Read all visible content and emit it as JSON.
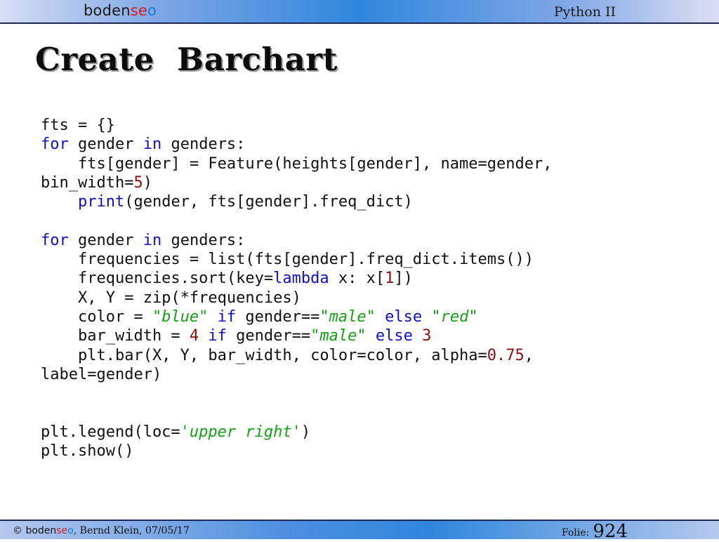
{
  "header": {
    "logo": {
      "part1": "boden",
      "part2": "se",
      "part3": "o"
    },
    "course": "Python II"
  },
  "slide": {
    "title": "Create  Barchart"
  },
  "code": {
    "lines": [
      [
        [
          "t",
          "fts = {}"
        ]
      ],
      [
        [
          "kw",
          "for"
        ],
        [
          "t",
          " gender "
        ],
        [
          "kw",
          "in"
        ],
        [
          "t",
          " genders:"
        ]
      ],
      [
        [
          "t",
          "    fts[gender] = Feature(heights[gender], name=gender,"
        ]
      ],
      [
        [
          "t",
          "bin_width="
        ],
        [
          "num",
          "5"
        ],
        [
          "t",
          ")"
        ]
      ],
      [
        [
          "t",
          "    "
        ],
        [
          "kw",
          "print"
        ],
        [
          "t",
          "(gender, fts[gender].freq_dict)"
        ]
      ],
      [],
      [
        [
          "kw",
          "for"
        ],
        [
          "t",
          " gender "
        ],
        [
          "kw",
          "in"
        ],
        [
          "t",
          " genders:"
        ]
      ],
      [
        [
          "t",
          "    frequencies = list(fts[gender].freq_dict.items())"
        ]
      ],
      [
        [
          "t",
          "    frequencies.sort(key="
        ],
        [
          "kw",
          "lambda"
        ],
        [
          "t",
          " x: x["
        ],
        [
          "num",
          "1"
        ],
        [
          "t",
          "])"
        ]
      ],
      [
        [
          "t",
          "    X, Y = zip(*frequencies)"
        ]
      ],
      [
        [
          "t",
          "    color = "
        ],
        [
          "str",
          "\"blue\""
        ],
        [
          "t",
          " "
        ],
        [
          "kw",
          "if"
        ],
        [
          "t",
          " gender=="
        ],
        [
          "str",
          "\"male\""
        ],
        [
          "t",
          " "
        ],
        [
          "kw",
          "else"
        ],
        [
          "t",
          " "
        ],
        [
          "str",
          "\"red\""
        ]
      ],
      [
        [
          "t",
          "    bar_width = "
        ],
        [
          "num",
          "4"
        ],
        [
          "t",
          " "
        ],
        [
          "kw",
          "if"
        ],
        [
          "t",
          " gender=="
        ],
        [
          "str",
          "\"male\""
        ],
        [
          "t",
          " "
        ],
        [
          "kw",
          "else"
        ],
        [
          "t",
          " "
        ],
        [
          "num",
          "3"
        ]
      ],
      [
        [
          "t",
          "    plt.bar(X, Y, bar_width, color=color, alpha="
        ],
        [
          "num",
          "0.75"
        ],
        [
          "t",
          ","
        ]
      ],
      [
        [
          "t",
          "label=gender)"
        ]
      ],
      [],
      [],
      [
        [
          "t",
          "plt.legend(loc="
        ],
        [
          "str",
          "'upper right'"
        ],
        [
          "t",
          ")"
        ]
      ],
      [
        [
          "t",
          "plt.show()"
        ]
      ]
    ]
  },
  "footer": {
    "copyright": "©",
    "brand": {
      "part1": "boden",
      "part2": "se",
      "part3": "o"
    },
    "author_date": ", Bernd Klein, 07/05/17",
    "folie_label": "Folie:",
    "folie_number": "924"
  }
}
